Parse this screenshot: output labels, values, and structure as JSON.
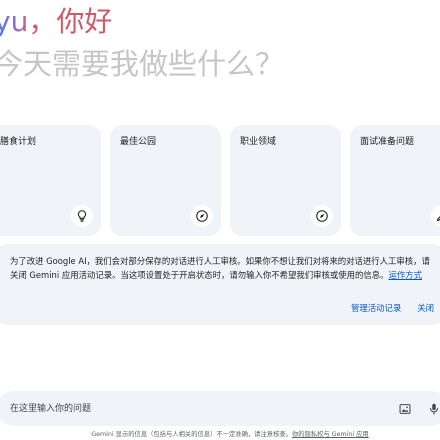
{
  "greeting": {
    "name": "yu",
    "separator": "，",
    "hello": "你好",
    "prompt": "今天需要我做些什么？"
  },
  "cards": [
    {
      "label": "膳食计划",
      "icon": "lightbulb-icon"
    },
    {
      "label": "最佳公园",
      "icon": "compass-icon"
    },
    {
      "label": "职业领域",
      "icon": "compass-icon"
    },
    {
      "label": "面试准备问题",
      "icon": "edit-sparkle-icon"
    }
  ],
  "notice": {
    "text": "为了改进 Google AI，我们会对部分保存的对话进行人工审核。如果你不想让我们对将来的对话进行人工审核，请关闭 Gemini 应用活动记录。当这项设置处于开启状态时，请勿输入你不希望我们审核或使用的信息。",
    "link": "运作方式",
    "manage_label": "管理活动记录",
    "close_label": "关闭"
  },
  "input": {
    "placeholder": "在这里输入你的问题",
    "image_icon": "image-upload-icon",
    "mic_icon": "microphone-icon"
  },
  "footer": {
    "text": "Gemini 显示的信息（包括与人相关的信息）不一定准确，请注意核查。",
    "link": "你的隐私权与 Gemini 应用"
  },
  "colors": {
    "surface": "#f0f4f9",
    "link": "#0b57d0",
    "greeting_accent": "#d05a69",
    "muted_text": "#c4c7c5"
  }
}
